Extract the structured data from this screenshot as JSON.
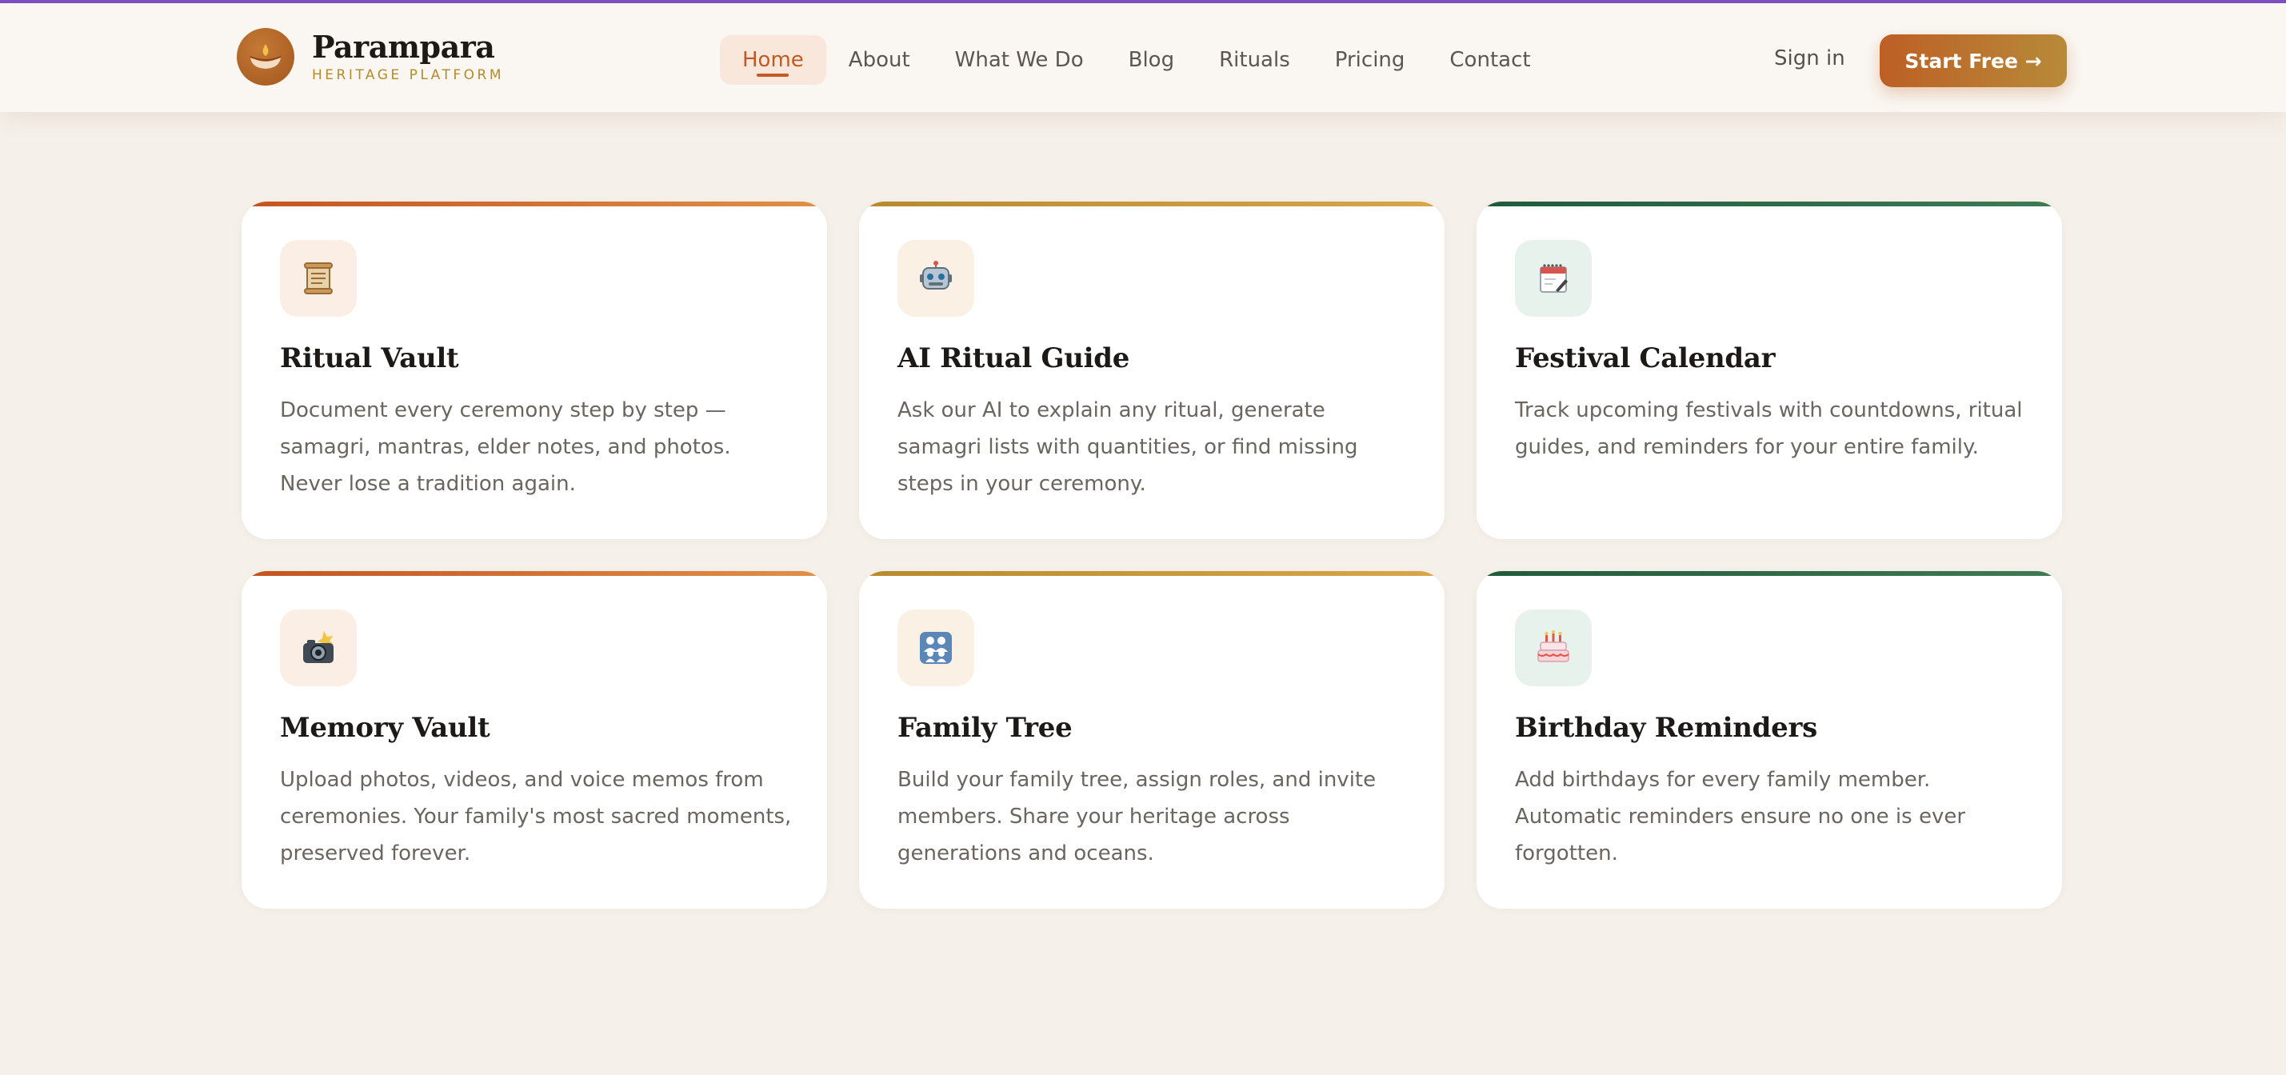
{
  "brand": {
    "name": "Parampara",
    "tagline": "HERITAGE PLATFORM",
    "logo_icon": "diya-lamp-icon"
  },
  "nav": {
    "items": [
      {
        "label": "Home",
        "active": true
      },
      {
        "label": "About"
      },
      {
        "label": "What We Do"
      },
      {
        "label": "Blog"
      },
      {
        "label": "Rituals"
      },
      {
        "label": "Pricing"
      },
      {
        "label": "Contact"
      }
    ],
    "sign_in": "Sign in",
    "cta": "Start Free →"
  },
  "features": [
    {
      "icon": "scroll-icon",
      "title": "Ritual Vault",
      "desc": "Document every ceremony step by step — samagri, mantras, elder notes, and photos. Never lose a tradition again."
    },
    {
      "icon": "robot-icon",
      "title": "AI Ritual Guide",
      "desc": "Ask our AI to explain any ritual, generate samagri lists with quantities, or find missing steps in your ceremony."
    },
    {
      "icon": "calendar-icon",
      "title": "Festival Calendar",
      "desc": "Track upcoming festivals with countdowns, ritual guides, and reminders for your entire family."
    },
    {
      "icon": "camera-flash-icon",
      "title": "Memory Vault",
      "desc": "Upload photos, videos, and voice memos from ceremonies. Your family's most sacred moments, preserved forever."
    },
    {
      "icon": "family-icon",
      "title": "Family Tree",
      "desc": "Build your family tree, assign roles, and invite members. Share your heritage across generations and oceans."
    },
    {
      "icon": "birthday-cake-icon",
      "title": "Birthday Reminders",
      "desc": "Add birthdays for every family member. Automatic reminders ensure no one is ever forgotten."
    }
  ],
  "colors": {
    "accent": "#c45a24",
    "gold": "#b78a2e",
    "green": "#2f6a48",
    "background": "#f5f0e9"
  }
}
